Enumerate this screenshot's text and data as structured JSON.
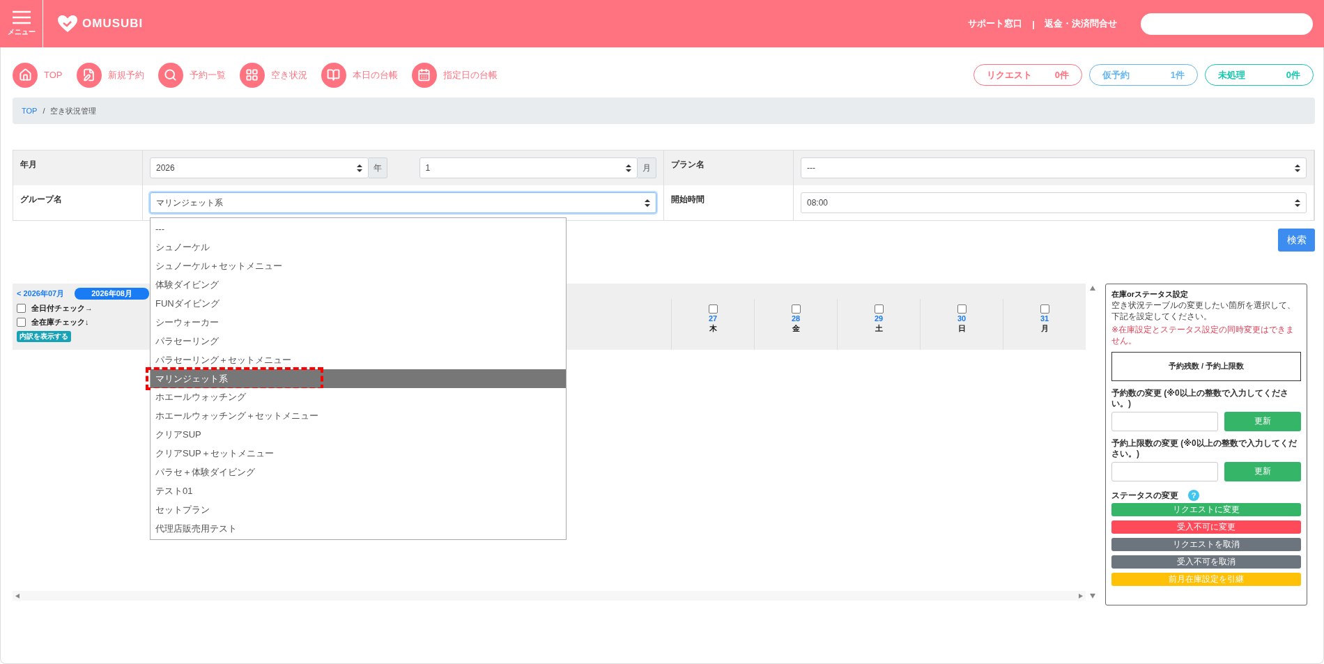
{
  "header": {
    "menu_label": "メニュー",
    "logo": "OMUSUBI",
    "links": [
      "サポート窓口",
      "返金・決済問合せ"
    ],
    "link_separator": "|"
  },
  "nav": [
    {
      "label": "TOP",
      "kind": "home"
    },
    {
      "label": "新規予約",
      "kind": "edit"
    },
    {
      "label": "予約一覧",
      "kind": "search"
    },
    {
      "label": "空き状況",
      "kind": "grid"
    },
    {
      "label": "本日の台帳",
      "kind": "book"
    },
    {
      "label": "指定日の台帳",
      "kind": "calendar"
    }
  ],
  "counters": [
    {
      "label": "リクエスト",
      "count": "0件",
      "color": "#ff6f7d"
    },
    {
      "label": "仮予約",
      "count": "1件",
      "color": "#66b6f2"
    },
    {
      "label": "未処理",
      "count": "0件",
      "color": "#14c7ad"
    }
  ],
  "breadcrumb": {
    "items": [
      "TOP",
      "空き状況管理"
    ],
    "separator": "/"
  },
  "form": {
    "year_month": {
      "label": "年月",
      "year": "2026",
      "year_unit": "年",
      "month": "1",
      "month_unit": "月"
    },
    "plan": {
      "label": "プラン名",
      "value": "---"
    },
    "group": {
      "label": "グループ名",
      "value": "マリンジェット系",
      "expanded": true,
      "options": [
        {
          "label": "---",
          "selected": false
        },
        {
          "label": "シュノーケル",
          "selected": false
        },
        {
          "label": "シュノーケル＋セットメニュー",
          "selected": false
        },
        {
          "label": "体験ダイビング",
          "selected": false
        },
        {
          "label": "FUNダイビング",
          "selected": false
        },
        {
          "label": "シーウォーカー",
          "selected": false
        },
        {
          "label": "パラセーリング",
          "selected": false
        },
        {
          "label": "パラセーリング＋セットメニュー",
          "selected": false
        },
        {
          "label": "マリンジェット系",
          "selected": true
        },
        {
          "label": "ホエールウォッチング",
          "selected": false
        },
        {
          "label": "ホエールウォッチング＋セットメニュー",
          "selected": false
        },
        {
          "label": "クリアSUP",
          "selected": false
        },
        {
          "label": "クリアSUP＋セットメニュー",
          "selected": false
        },
        {
          "label": "パラセ＋体験ダイビング",
          "selected": false
        },
        {
          "label": "テスト01",
          "selected": false
        },
        {
          "label": "セットプラン",
          "selected": false
        },
        {
          "label": "代理店販売用テスト",
          "selected": false
        }
      ]
    },
    "start_time": {
      "label": "開始時間",
      "value": "08:00"
    }
  },
  "search_button": "検索",
  "calendar": {
    "prev": "< 2026年07月",
    "current": "2026年08月",
    "checks": [
      {
        "label": "全日付チェック→",
        "checked": false
      },
      {
        "label": "全在庫チェック↓",
        "checked": false
      }
    ],
    "breakdown_button": "内訳を表示する",
    "days": [
      {
        "date": "27",
        "weekday": "木",
        "checked": false
      },
      {
        "date": "28",
        "weekday": "金",
        "checked": false
      },
      {
        "date": "29",
        "weekday": "土",
        "checked": false
      },
      {
        "date": "30",
        "weekday": "日",
        "checked": false
      },
      {
        "date": "31",
        "weekday": "月",
        "checked": false
      }
    ]
  },
  "panel": {
    "title": "在庫orステータス設定",
    "description": "空き状況テーブルの変更したい箇所を選択して、下記を設定してください。",
    "note": "※在庫設定とステータス設定の同時変更はできません。",
    "legend": "予約残数 / 予約上限数",
    "fields": [
      {
        "label": "予約数の変更 (※0以上の整数で入力してください。)",
        "button": "更新"
      },
      {
        "label": "予約上限数の変更 (※0以上の整数で入力してください。)",
        "button": "更新"
      }
    ],
    "status_label": "ステータスの変更",
    "help": "?",
    "status_buttons": [
      {
        "label": "リクエストに変更",
        "kind": "success"
      },
      {
        "label": "受入不可に変更",
        "kind": "danger"
      },
      {
        "label": "リクエストを取消",
        "kind": "secondary"
      },
      {
        "label": "受入不可を取消",
        "kind": "secondary"
      },
      {
        "label": "前月在庫設定を引継",
        "kind": "warning"
      }
    ]
  }
}
